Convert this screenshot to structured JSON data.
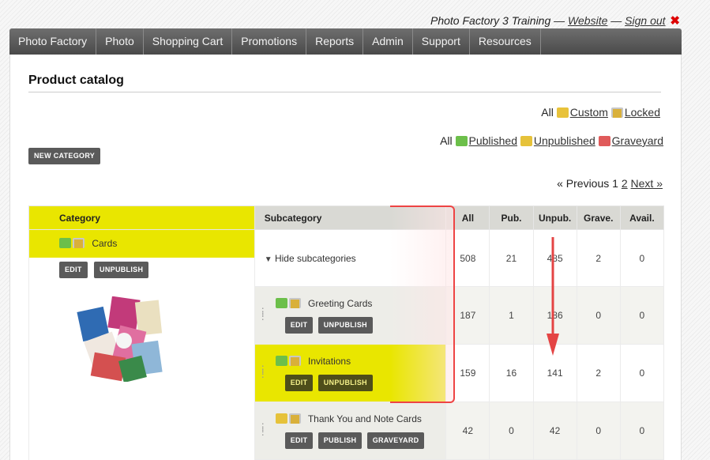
{
  "header": {
    "site_name": "Photo Factory 3 Training",
    "sep1": "—",
    "website_link": "Website",
    "sep2": "—",
    "signout_link": "Sign out",
    "close_glyph": "✖"
  },
  "nav": {
    "items": [
      "Photo Factory",
      "Photo",
      "Shopping Cart",
      "Promotions",
      "Reports",
      "Admin",
      "Support",
      "Resources"
    ]
  },
  "page": {
    "title": "Product catalog",
    "new_category_label": "NEW CATEGORY"
  },
  "filters": {
    "row1": {
      "all": "All",
      "custom": "Custom",
      "locked": "Locked"
    },
    "row2": {
      "all": "All",
      "published": "Published",
      "unpublished": "Unpublished",
      "graveyard": "Graveyard"
    }
  },
  "pager": {
    "previous": "« Previous",
    "current": "1",
    "page2": "2",
    "next": "Next »"
  },
  "table": {
    "headers": {
      "category": "Category",
      "subcategory": "Subcategory",
      "all": "All",
      "pub": "Pub.",
      "unpub": "Unpub.",
      "grave": "Grave.",
      "avail": "Avail."
    },
    "category": {
      "name": "Cards",
      "edit": "EDIT",
      "unpublish": "UNPUBLISH"
    },
    "toggle_label": "Hide subcategories",
    "toggle_row": {
      "all": "508",
      "pub": "21",
      "unpub": "485",
      "grave": "2",
      "avail": "0"
    },
    "rows": [
      {
        "name": "Greeting Cards",
        "btn1": "EDIT",
        "btn2": "UNPUBLISH",
        "btn3": "",
        "all": "187",
        "pub": "1",
        "unpub": "186",
        "grave": "0",
        "avail": "0"
      },
      {
        "name": "Invitations",
        "btn1": "EDIT",
        "btn2": "UNPUBLISH",
        "btn3": "",
        "all": "159",
        "pub": "16",
        "unpub": "141",
        "grave": "2",
        "avail": "0"
      },
      {
        "name": "Thank You and Note Cards",
        "btn1": "EDIT",
        "btn2": "PUBLISH",
        "btn3": "GRAVEYARD",
        "all": "42",
        "pub": "0",
        "unpub": "42",
        "grave": "0",
        "avail": "0"
      }
    ]
  },
  "colors": {
    "highlight": "#e9e600",
    "nav_bg": "#5a5a5a",
    "annotation": "#e44444"
  }
}
